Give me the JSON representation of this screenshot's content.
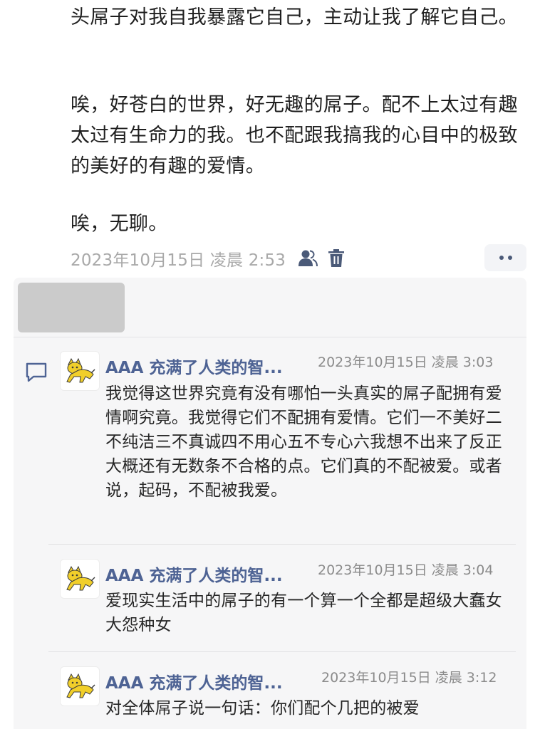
{
  "post": {
    "paragraphs": [
      "头屌子对我自我暴露它自己，主动让我了解它自己。",
      "唉，好苍白的世界，好无趣的屌子。配不上太过有趣太过有生命力的我。也不配跟我搞我的心目中的极致的美好的有趣的爱情。",
      "唉，无聊。"
    ],
    "timestamp": "2023年10月15日 凌晨 2:53",
    "icons": {
      "visibility": "person-group-icon",
      "delete": "trash-icon",
      "more": "more-dots-icon"
    },
    "colors": {
      "text": "#1f1f1f",
      "meta": "#a9a9a9",
      "accent": "#4b5a78"
    }
  },
  "comments": {
    "icon": "comment-bubble-icon",
    "items": [
      {
        "author": "AAA 充满了人类的智...",
        "time": "2023年10月15日 凌晨 3:03",
        "text": "我觉得这世界究竟有没有哪怕一头真实的屌子配拥有爱情啊究竟。我觉得它们不配拥有爱情。它们一不美好二不纯洁三不真诚四不用心五不专心六我想不出来了反正大概还有无数条不合格的点。它们真的不配被爱。或者说，起码，不配被我爱。"
      },
      {
        "author": "AAA 充满了人类的智...",
        "time": "2023年10月15日 凌晨 3:04",
        "text": "爱现实生活中的屌子的有一个算一个全都是超级大蠢女大怨种女"
      },
      {
        "author": "AAA 充满了人类的智...",
        "time": "2023年10月15日 凌晨 3:12",
        "text": "对全体屌子说一句话：你们配个几把的被爱"
      }
    ],
    "colors": {
      "author": "#4e6394",
      "time": "#8b8b8b",
      "panel": "#f6f6f7"
    }
  }
}
